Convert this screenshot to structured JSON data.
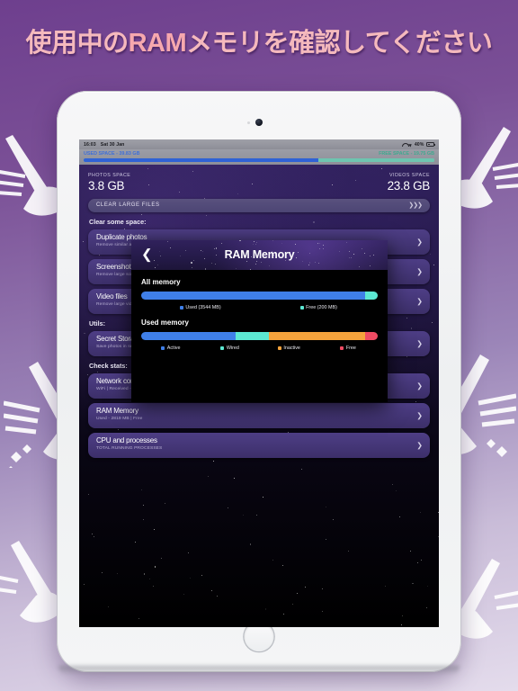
{
  "headline": {
    "prefix": "使用中の",
    "ram": "RAM",
    "suffix": "メモリを確認してください"
  },
  "device": {
    "status_bar": {
      "time": "16:03",
      "date": "Sat 30 Jan",
      "battery": "40%",
      "wifi_icon": "wifi-icon",
      "location_icon": "location-arrow-icon",
      "battery_icon": "battery-icon"
    }
  },
  "app": {
    "storage": {
      "used_label": "USED SPACE - 39.83 GB",
      "free_label": "FREE SPACE - 19.75 GB"
    },
    "space": {
      "photos_caption": "PHOTOS SPACE",
      "photos_value": "3.8 GB",
      "videos_caption": "VIDEOS SPACE",
      "videos_value": "23.8 GB"
    },
    "clear_button": {
      "label": "CLEAR LARGE FILES",
      "chevrons": "❯❯❯"
    },
    "sections": [
      {
        "title": "Clear some space:"
      },
      {
        "title": "Utils:"
      },
      {
        "title": "Check stats:"
      }
    ],
    "cards_clear": [
      {
        "title": "Duplicate photos",
        "subtitle": "Remove similar and duplicate photos",
        "chevron": "❯"
      },
      {
        "title": "Screenshot files",
        "subtitle": "Remove large screenshots",
        "chevron": "❯"
      },
      {
        "title": "Video files",
        "subtitle": "Remove large videos",
        "chevron": "❯"
      }
    ],
    "cards_utils": [
      {
        "title": "Secret Storage",
        "subtitle": "Save photos in secret storage",
        "chevron": "❯"
      }
    ],
    "cards_stats": [
      {
        "title": "Network connection",
        "subtitle": "WiFi | Received - Data",
        "chevron": "❯"
      },
      {
        "title": "RAM Memory",
        "subtitle": "Used - 2819 MB | Free",
        "chevron": "❯"
      },
      {
        "title": "CPU and processes",
        "subtitle": "TOTAL RUNNING PROCESSES",
        "chevron": "❯"
      }
    ]
  },
  "modal": {
    "title": "RAM Memory",
    "back_icon": "back-chevron-icon",
    "all_memory_heading": "All memory",
    "used_memory_heading": "Used memory"
  },
  "chart_data": [
    {
      "type": "bar",
      "title": "All memory",
      "orientation": "horizontal-stacked",
      "categories": [
        "Used",
        "Free"
      ],
      "values": [
        3544,
        200
      ],
      "unit": "MB",
      "percents": [
        94.7,
        5.3
      ],
      "legend": [
        {
          "label": "Used (3544 MB)",
          "color": "#3f7fe8"
        },
        {
          "label": "Free (200 MB)",
          "color": "#5ce8d2"
        }
      ],
      "legend_position": "bottom",
      "grid": false
    },
    {
      "type": "bar",
      "title": "Used memory",
      "orientation": "horizontal-stacked",
      "categories": [
        "Active",
        "Wired",
        "Inactive",
        "Free"
      ],
      "percents": [
        40.0,
        14.0,
        40.5,
        5.5
      ],
      "legend": [
        {
          "label": "Active",
          "color": "#3f7fe8"
        },
        {
          "label": "Wired",
          "color": "#5ce8d2"
        },
        {
          "label": "Inactive",
          "color": "#f5a33c"
        },
        {
          "label": "Free",
          "color": "#ef4b63"
        }
      ],
      "legend_position": "bottom",
      "grid": false
    }
  ]
}
